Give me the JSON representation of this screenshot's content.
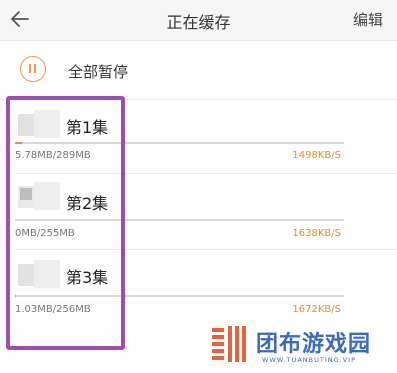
{
  "header": {
    "title": "正在缓存",
    "edit_label": "编辑"
  },
  "pause_all": {
    "label": "全部暂停"
  },
  "episodes": [
    {
      "title": "第1集",
      "size": "5.78MB/289MB",
      "speed": "1498KB/S",
      "progress": 0.02
    },
    {
      "title": "第2集",
      "size": "0MB/255MB",
      "speed": "1638KB/S",
      "progress": 0.0
    },
    {
      "title": "第3集",
      "size": "1.03MB/256MB",
      "speed": "1672KB/S",
      "progress": 0.004
    }
  ],
  "watermark": {
    "name": "团布游戏园",
    "url": "WWW.TUANBUTING.VIP"
  },
  "colors": {
    "accent": "#f08a2e",
    "highlight": "#9b4fb0",
    "watermark": "#3a6bc4"
  },
  "icons": {
    "back": "back-arrow-icon",
    "pause": "pause-circle-icon"
  }
}
